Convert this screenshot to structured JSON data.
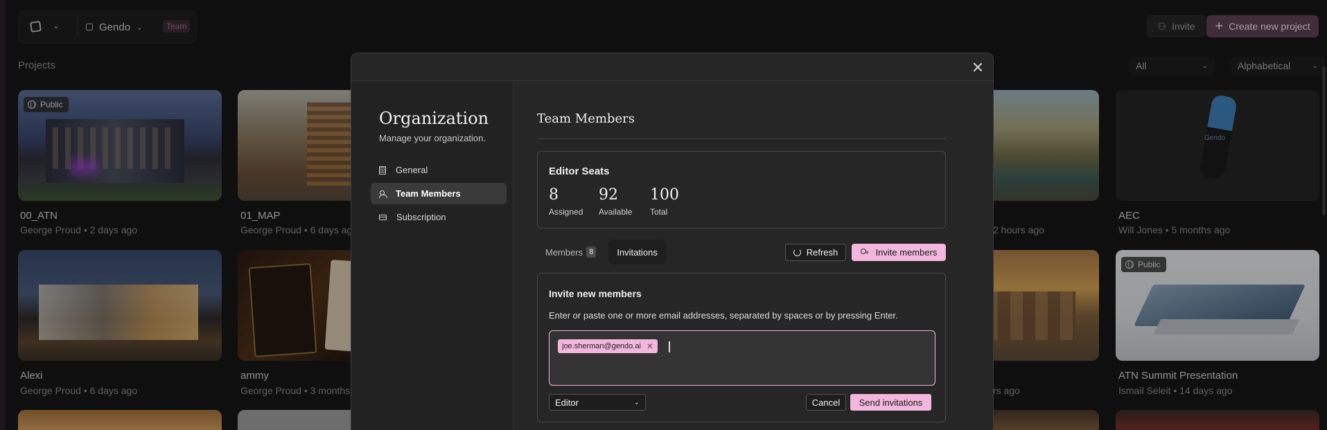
{
  "topbar": {
    "workspace_name": "Gendo",
    "workspace_badge": "Team",
    "invite_label": "Invite",
    "create_label": "Create new project"
  },
  "projects": {
    "heading": "Projects",
    "filter_value": "All",
    "sort_value": "Alphabetical",
    "cards": [
      {
        "title": "00_ATN",
        "meta": "George Proud • 2 days ago",
        "badge": "Public"
      },
      {
        "title": "01_MAP",
        "meta": "George Proud • 6 days ago"
      },
      {
        "title": "",
        "meta": "2 hours ago"
      },
      {
        "title": "AEC",
        "meta": "Will Jones • 5 months ago",
        "watermark": "Gendo"
      },
      {
        "title": "Alexi",
        "meta": "George Proud • 6 days ago"
      },
      {
        "title": "ammy",
        "meta": "George Proud • 3 months"
      },
      {
        "title": "",
        "meta": "rs ago"
      },
      {
        "title": "ATN Summit Presentation",
        "meta": "Ismail Seleit • 14 days ago",
        "badge": "Public"
      }
    ]
  },
  "modal": {
    "org_title": "Organization",
    "org_subtitle": "Manage your organization.",
    "nav": [
      {
        "label": "General",
        "icon": "building-icon"
      },
      {
        "label": "Team Members",
        "icon": "users-icon"
      },
      {
        "label": "Subscription",
        "icon": "credit-card-icon"
      }
    ],
    "section_title": "Team Members",
    "seats": {
      "title": "Editor Seats",
      "assigned_value": "8",
      "assigned_label": "Assigned",
      "available_value": "92",
      "available_label": "Available",
      "total_value": "100",
      "total_label": "Total"
    },
    "tabs": {
      "members_label": "Members",
      "members_count": "8",
      "invitations_label": "Invitations"
    },
    "refresh_label": "Refresh",
    "invite_members_label": "Invite members",
    "invite": {
      "title": "Invite new members",
      "description": "Enter or paste one or more email addresses, separated by spaces or by pressing Enter.",
      "emails": [
        "joe.sherman@gendo.ai"
      ],
      "role_value": "Editor",
      "cancel_label": "Cancel",
      "send_label": "Send invitations"
    }
  },
  "colors": {
    "accent_pink": "#f3b7dd",
    "background": "#161616",
    "modal_bg": "#262626"
  }
}
